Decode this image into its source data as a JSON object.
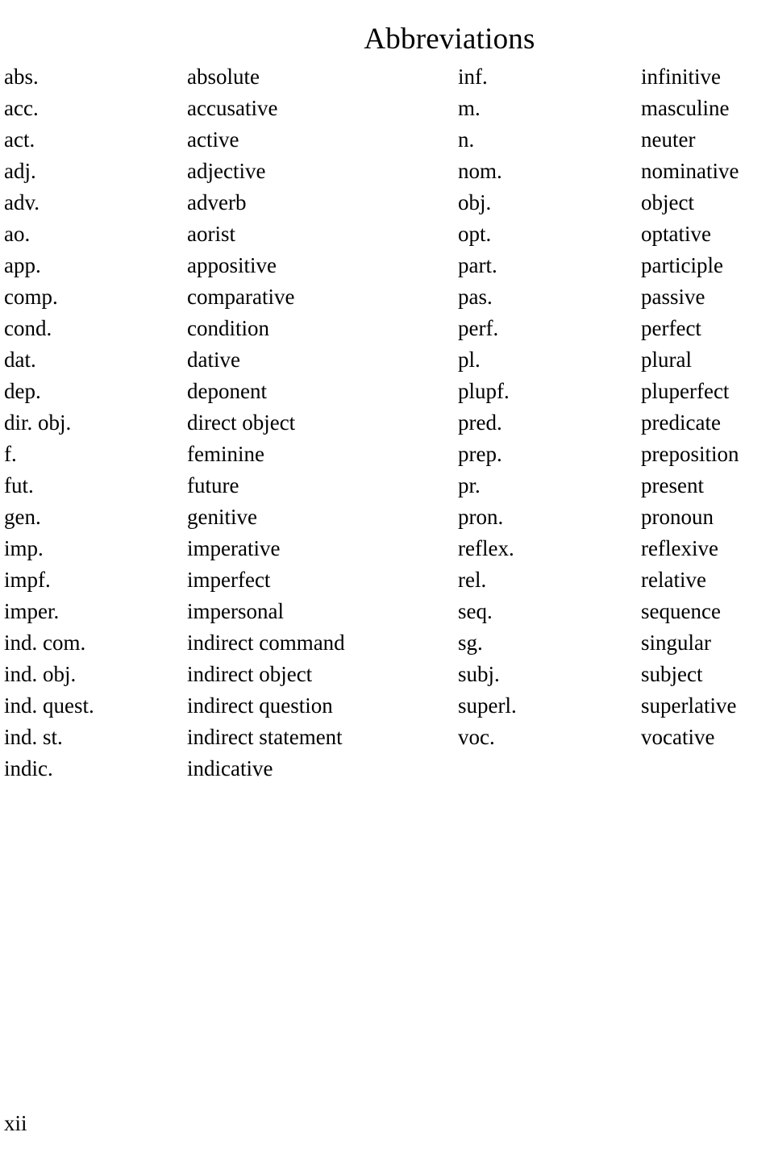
{
  "page": {
    "title": "Abbreviations",
    "folio": "xii",
    "text_color": "#000000",
    "background_color": "#ffffff"
  },
  "columns": {
    "left": [
      {
        "abbr": "abs.",
        "definition": "absolute"
      },
      {
        "abbr": "acc.",
        "definition": "accusative"
      },
      {
        "abbr": "act.",
        "definition": "active"
      },
      {
        "abbr": "adj.",
        "definition": "adjective"
      },
      {
        "abbr": "adv.",
        "definition": "adverb"
      },
      {
        "abbr": "ao.",
        "definition": "aorist"
      },
      {
        "abbr": "app.",
        "definition": "appositive"
      },
      {
        "abbr": "comp.",
        "definition": "comparative"
      },
      {
        "abbr": "cond.",
        "definition": "condition"
      },
      {
        "abbr": "dat.",
        "definition": "dative"
      },
      {
        "abbr": "dep.",
        "definition": "deponent"
      },
      {
        "abbr": "dir. obj.",
        "definition": "direct object"
      },
      {
        "abbr": "f.",
        "definition": "feminine"
      },
      {
        "abbr": "fut.",
        "definition": "future"
      },
      {
        "abbr": "gen.",
        "definition": "genitive"
      },
      {
        "abbr": "imp.",
        "definition": "imperative"
      },
      {
        "abbr": "impf.",
        "definition": "imperfect"
      },
      {
        "abbr": "imper.",
        "definition": "impersonal"
      },
      {
        "abbr": "ind. com.",
        "definition": "indirect command"
      },
      {
        "abbr": "ind. obj.",
        "definition": "indirect object"
      },
      {
        "abbr": "ind. quest.",
        "definition": "indirect question"
      },
      {
        "abbr": "ind. st.",
        "definition": "indirect statement"
      },
      {
        "abbr": "indic.",
        "definition": "indicative"
      }
    ],
    "right": [
      {
        "abbr": "inf.",
        "definition": "infinitive"
      },
      {
        "abbr": "m.",
        "definition": "masculine"
      },
      {
        "abbr": "n.",
        "definition": "neuter"
      },
      {
        "abbr": "nom.",
        "definition": "nominative"
      },
      {
        "abbr": "obj.",
        "definition": "object"
      },
      {
        "abbr": "opt.",
        "definition": "optative"
      },
      {
        "abbr": "part.",
        "definition": "participle"
      },
      {
        "abbr": "pas.",
        "definition": "passive"
      },
      {
        "abbr": "perf.",
        "definition": "perfect"
      },
      {
        "abbr": "pl.",
        "definition": "plural"
      },
      {
        "abbr": "plupf.",
        "definition": "pluperfect"
      },
      {
        "abbr": "pred.",
        "definition": "predicate"
      },
      {
        "abbr": "prep.",
        "definition": "preposition"
      },
      {
        "abbr": "pr.",
        "definition": "present"
      },
      {
        "abbr": "pron.",
        "definition": "pronoun"
      },
      {
        "abbr": "reflex.",
        "definition": "reflexive"
      },
      {
        "abbr": "rel.",
        "definition": "relative"
      },
      {
        "abbr": "seq.",
        "definition": "sequence"
      },
      {
        "abbr": "sg.",
        "definition": "singular"
      },
      {
        "abbr": "subj.",
        "definition": "subject"
      },
      {
        "abbr": "superl.",
        "definition": "superlative"
      },
      {
        "abbr": "voc.",
        "definition": "vocative"
      }
    ]
  }
}
